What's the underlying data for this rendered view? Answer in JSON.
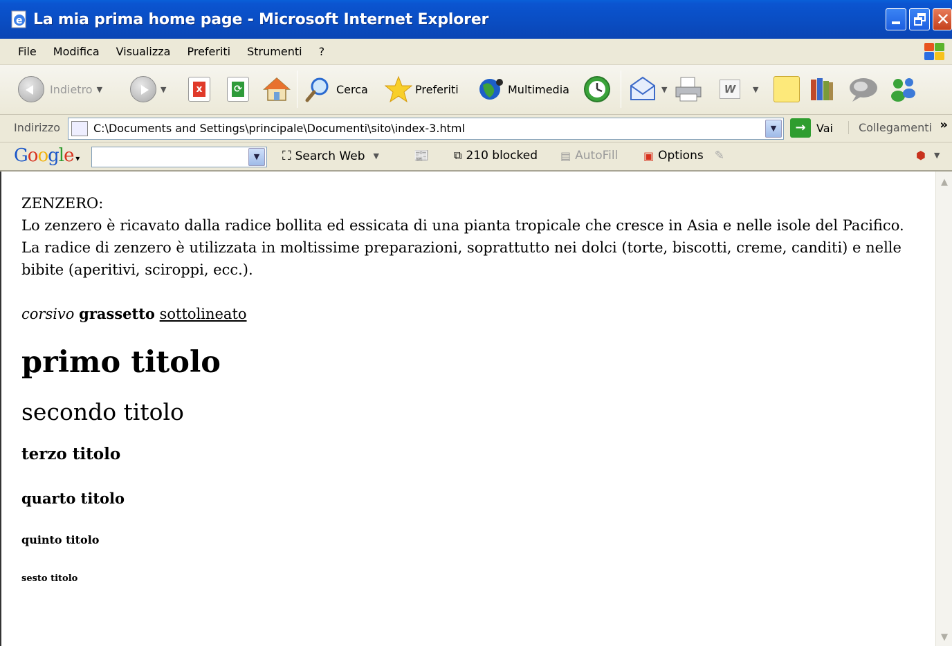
{
  "window": {
    "title": "La mia prima home page - Microsoft Internet Explorer"
  },
  "menu": [
    "File",
    "Modifica",
    "Visualizza",
    "Preferiti",
    "Strumenti",
    "?"
  ],
  "toolbar": {
    "back_label": "Indietro",
    "search_label": "Cerca",
    "favorites_label": "Preferiti",
    "media_label": "Multimedia"
  },
  "address": {
    "label": "Indirizzo",
    "url": "C:\\Documents and Settings\\principale\\Documenti\\sito\\index-3.html",
    "go_label": "Vai",
    "links_label": "Collegamenti"
  },
  "google_toolbar": {
    "logo": "Google",
    "search_web_label": "Search Web",
    "blocked_label": "210 blocked",
    "autofill_label": "AutoFill",
    "options_label": "Options"
  },
  "page": {
    "heading_line": "ZENZERO:",
    "paragraph": "Lo zenzero è ricavato dalla radice bollita ed essicata di una pianta tropicale che cresce in Asia e nelle isole del Pacifico. La radice di zenzero è utilizzata in moltissime preparazioni, soprattutto nei dolci (torte, biscotti, creme, canditi) e nelle bibite (aperitivi, sciroppi, ecc.).",
    "italic": "corsivo",
    "bold": "grassetto",
    "underline": "sottolineato",
    "h1": "primo titolo",
    "h2": "secondo titolo",
    "h3": "terzo titolo",
    "h4": "quarto titolo",
    "h5": "quinto titolo",
    "h6": "sesto titolo"
  },
  "colors": {
    "titlebar": "#0a4ec4",
    "chrome": "#ece9d8",
    "close_button": "#c5401b"
  }
}
